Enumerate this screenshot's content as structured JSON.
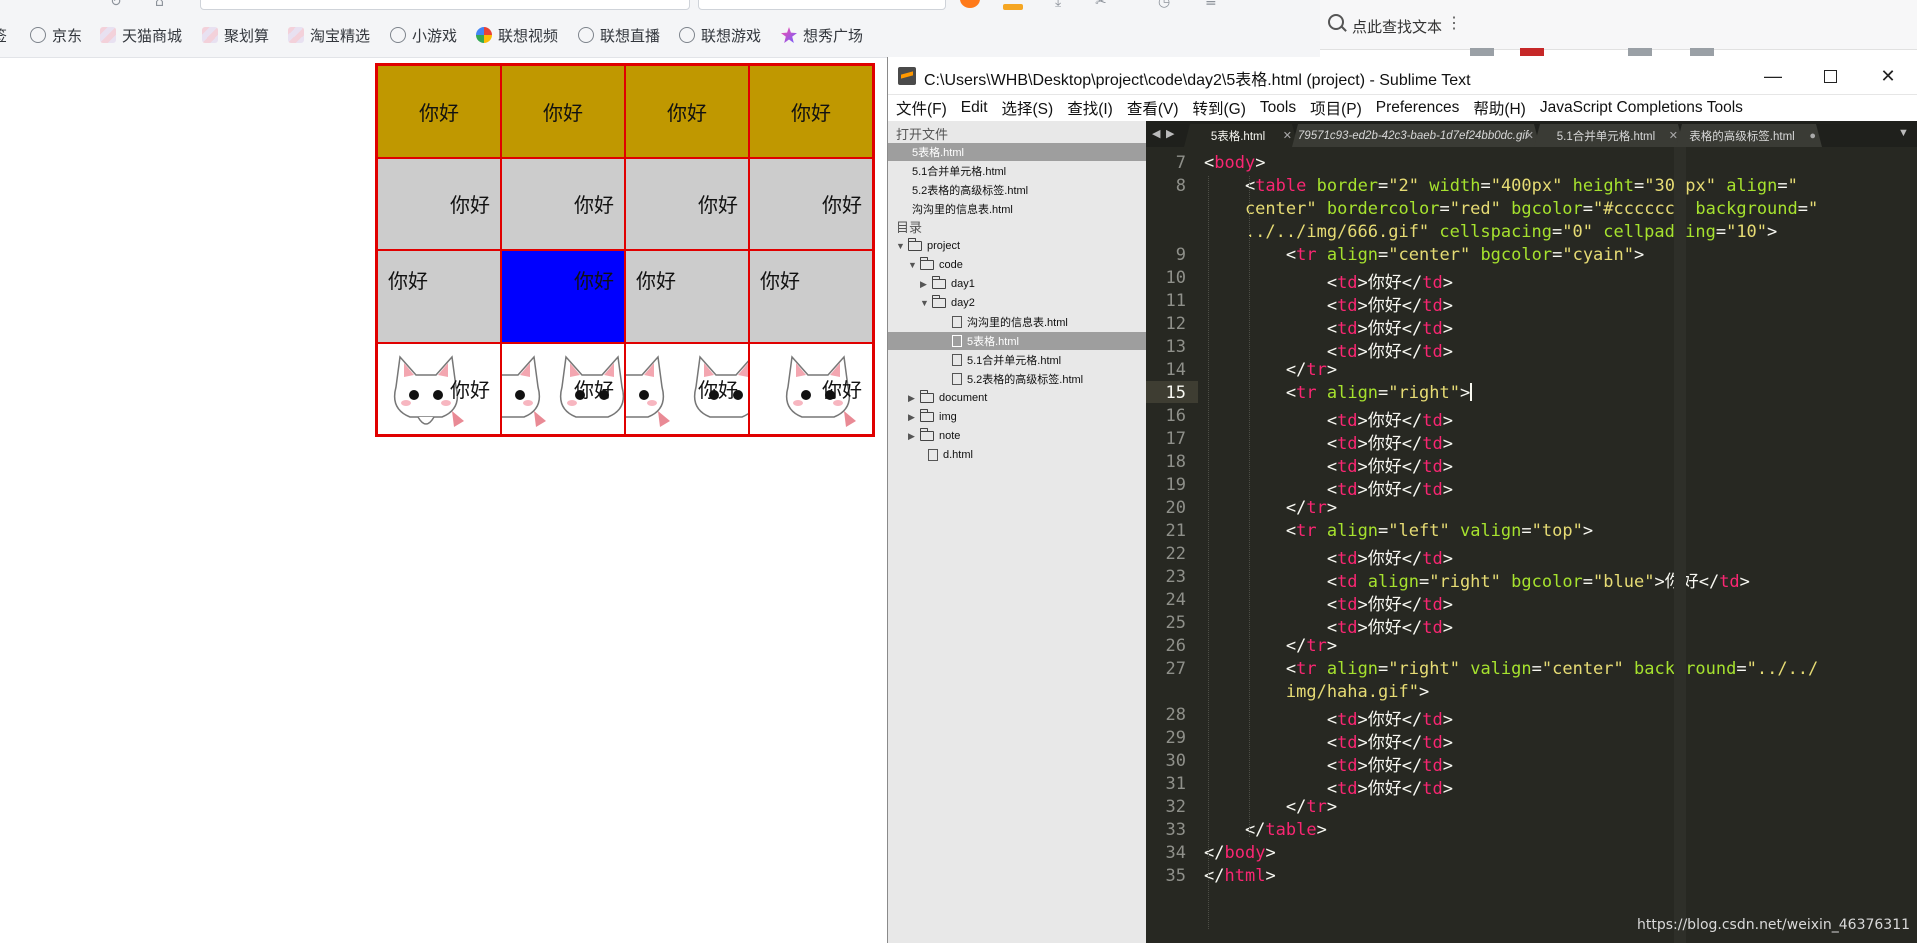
{
  "browser": {
    "bookmarks": [
      {
        "label": "京东",
        "icon": "globe-icon"
      },
      {
        "label": "天猫商城",
        "icon": "brand-icon"
      },
      {
        "label": "聚划算",
        "icon": "brand-icon"
      },
      {
        "label": "淘宝精选",
        "icon": "brand-icon"
      },
      {
        "label": "小游戏",
        "icon": "globe-icon"
      },
      {
        "label": "联想视频",
        "icon": "video-icon"
      },
      {
        "label": "联想直播",
        "icon": "globe-icon"
      },
      {
        "label": "联想游戏",
        "icon": "globe-icon"
      },
      {
        "label": "想秀广场",
        "icon": "star-icon"
      }
    ]
  },
  "table": {
    "rows": [
      [
        "你好",
        "你好",
        "你好",
        "你好"
      ],
      [
        "你好",
        "你好",
        "你好",
        "你好"
      ],
      [
        "你好",
        "你好",
        "你好",
        "你好"
      ],
      [
        "你好",
        "你好",
        "你好",
        "你好"
      ]
    ],
    "colors": {
      "row1": "#c09800",
      "default": "#cccccc",
      "highlight": "#0000ff",
      "border": "#e00000"
    }
  },
  "reader": {
    "search_label": "点此查找文本",
    "more_glyph": "⋮"
  },
  "sublime": {
    "title": "C:\\Users\\WHB\\Desktop\\project\\code\\day2\\5表格.html (project) - Sublime Text",
    "window_buttons": {
      "minimize": "—",
      "close": "✕"
    },
    "menu": [
      "文件(F)",
      "Edit",
      "选择(S)",
      "查找(I)",
      "查看(V)",
      "转到(G)",
      "Tools",
      "项目(P)",
      "Preferences",
      "帮助(H)",
      "JavaScript Completions Tools"
    ],
    "sidebar": {
      "open_files_header": "打开文件",
      "open_files": [
        "5表格.html",
        "5.1合并单元格.html",
        "5.2表格的高级标签.html",
        "沟沟里的信息表.html"
      ],
      "folders_header": "目录",
      "tree": [
        {
          "label": "project",
          "type": "folder",
          "level": 0,
          "open": true
        },
        {
          "label": "code",
          "type": "folder",
          "level": 1,
          "open": true
        },
        {
          "label": "day1",
          "type": "folder",
          "level": 2,
          "open": false
        },
        {
          "label": "day2",
          "type": "folder",
          "level": 2,
          "open": true
        },
        {
          "label": "沟沟里的信息表.html",
          "type": "file",
          "level": 3
        },
        {
          "label": "5表格.html",
          "type": "file",
          "level": 3,
          "selected": true
        },
        {
          "label": "5.1合并单元格.html",
          "type": "file",
          "level": 3
        },
        {
          "label": "5.2表格的高级标签.html",
          "type": "file",
          "level": 3
        },
        {
          "label": "document",
          "type": "folder",
          "level": 1,
          "open": false
        },
        {
          "label": "img",
          "type": "folder",
          "level": 1,
          "open": false
        },
        {
          "label": "note",
          "type": "folder",
          "level": 1,
          "open": false
        },
        {
          "label": "d.html",
          "type": "file",
          "level": 1
        }
      ]
    },
    "tabs": [
      {
        "label": "5表格.html",
        "active": true
      },
      {
        "label": "79571c93-ed2b-42c3-baeb-1d7ef24bb0dc.gif",
        "italic": true
      },
      {
        "label": "5.1合并单元格.html"
      },
      {
        "label": "表格的高级标签.html",
        "dirty": true
      }
    ],
    "tab_nav": {
      "left": "◀",
      "right": "▶",
      "more": "▼"
    },
    "current_line": "15",
    "lines": [
      {
        "n": "7",
        "code": [
          [
            "t",
            "<"
          ],
          [
            "k",
            "body"
          ],
          [
            "t",
            ">"
          ]
        ]
      },
      {
        "n": "8",
        "code": [
          [
            "t",
            "    <"
          ],
          [
            "k",
            "table"
          ],
          [
            "t",
            " "
          ],
          [
            "a",
            "border"
          ],
          [
            "t",
            "="
          ],
          [
            "s",
            "\"2\""
          ],
          [
            "t",
            " "
          ],
          [
            "a",
            "width"
          ],
          [
            "t",
            "="
          ],
          [
            "s",
            "\"400px\""
          ],
          [
            "t",
            " "
          ],
          [
            "a",
            "height"
          ],
          [
            "t",
            "="
          ],
          [
            "s",
            "\"300px\""
          ],
          [
            "t",
            " "
          ],
          [
            "a",
            "align"
          ],
          [
            "t",
            "="
          ],
          [
            "s",
            "\""
          ]
        ]
      },
      {
        "n": "",
        "code": [
          [
            "s",
            "    center\""
          ],
          [
            "t",
            " "
          ],
          [
            "a",
            "bordercolor"
          ],
          [
            "t",
            "="
          ],
          [
            "s",
            "\"red\""
          ],
          [
            "t",
            " "
          ],
          [
            "a",
            "bgcolor"
          ],
          [
            "t",
            "="
          ],
          [
            "s",
            "\"#cccccc\""
          ],
          [
            "t",
            " "
          ],
          [
            "a",
            "background"
          ],
          [
            "t",
            "="
          ],
          [
            "s",
            "\""
          ]
        ]
      },
      {
        "n": "",
        "code": [
          [
            "s",
            "    ../../img/666.gif\""
          ],
          [
            "t",
            " "
          ],
          [
            "a",
            "cellspacing"
          ],
          [
            "t",
            "="
          ],
          [
            "s",
            "\"0\""
          ],
          [
            "t",
            " "
          ],
          [
            "a",
            "cellpadding"
          ],
          [
            "t",
            "="
          ],
          [
            "s",
            "\"10\""
          ],
          [
            "t",
            ">"
          ]
        ]
      },
      {
        "n": "9",
        "code": [
          [
            "t",
            "        <"
          ],
          [
            "k",
            "tr"
          ],
          [
            "t",
            " "
          ],
          [
            "a",
            "align"
          ],
          [
            "t",
            "="
          ],
          [
            "s",
            "\"center\""
          ],
          [
            "t",
            " "
          ],
          [
            "a",
            "bgcolor"
          ],
          [
            "t",
            "="
          ],
          [
            "s",
            "\"cyain\""
          ],
          [
            "t",
            ">"
          ]
        ]
      },
      {
        "n": "10",
        "code": [
          [
            "t",
            "            <"
          ],
          [
            "k",
            "td"
          ],
          [
            "t",
            ">你好</"
          ],
          [
            "k",
            "td"
          ],
          [
            "t",
            ">"
          ]
        ]
      },
      {
        "n": "11",
        "code": [
          [
            "t",
            "            <"
          ],
          [
            "k",
            "td"
          ],
          [
            "t",
            ">你好</"
          ],
          [
            "k",
            "td"
          ],
          [
            "t",
            ">"
          ]
        ]
      },
      {
        "n": "12",
        "code": [
          [
            "t",
            "            <"
          ],
          [
            "k",
            "td"
          ],
          [
            "t",
            ">你好</"
          ],
          [
            "k",
            "td"
          ],
          [
            "t",
            ">"
          ]
        ]
      },
      {
        "n": "13",
        "code": [
          [
            "t",
            "            <"
          ],
          [
            "k",
            "td"
          ],
          [
            "t",
            ">你好</"
          ],
          [
            "k",
            "td"
          ],
          [
            "t",
            ">"
          ]
        ]
      },
      {
        "n": "14",
        "code": [
          [
            "t",
            "        </"
          ],
          [
            "k",
            "tr"
          ],
          [
            "t",
            ">"
          ]
        ]
      },
      {
        "n": "15",
        "code": [
          [
            "t",
            "        <"
          ],
          [
            "k",
            "tr"
          ],
          [
            "t",
            " "
          ],
          [
            "a",
            "align"
          ],
          [
            "t",
            "="
          ],
          [
            "s",
            "\"right\""
          ],
          [
            "t",
            ">"
          ],
          [
            "c",
            ""
          ]
        ]
      },
      {
        "n": "16",
        "code": [
          [
            "t",
            "            <"
          ],
          [
            "k",
            "td"
          ],
          [
            "t",
            ">你好</"
          ],
          [
            "k",
            "td"
          ],
          [
            "t",
            ">"
          ]
        ]
      },
      {
        "n": "17",
        "code": [
          [
            "t",
            "            <"
          ],
          [
            "k",
            "td"
          ],
          [
            "t",
            ">你好</"
          ],
          [
            "k",
            "td"
          ],
          [
            "t",
            ">"
          ]
        ]
      },
      {
        "n": "18",
        "code": [
          [
            "t",
            "            <"
          ],
          [
            "k",
            "td"
          ],
          [
            "t",
            ">你好</"
          ],
          [
            "k",
            "td"
          ],
          [
            "t",
            ">"
          ]
        ]
      },
      {
        "n": "19",
        "code": [
          [
            "t",
            "            <"
          ],
          [
            "k",
            "td"
          ],
          [
            "t",
            ">你好</"
          ],
          [
            "k",
            "td"
          ],
          [
            "t",
            ">"
          ]
        ]
      },
      {
        "n": "20",
        "code": [
          [
            "t",
            "        </"
          ],
          [
            "k",
            "tr"
          ],
          [
            "t",
            ">"
          ]
        ]
      },
      {
        "n": "21",
        "code": [
          [
            "t",
            "        <"
          ],
          [
            "k",
            "tr"
          ],
          [
            "t",
            " "
          ],
          [
            "a",
            "align"
          ],
          [
            "t",
            "="
          ],
          [
            "s",
            "\"left\""
          ],
          [
            "t",
            " "
          ],
          [
            "a",
            "valign"
          ],
          [
            "t",
            "="
          ],
          [
            "s",
            "\"top\""
          ],
          [
            "t",
            ">"
          ]
        ]
      },
      {
        "n": "22",
        "code": [
          [
            "t",
            "            <"
          ],
          [
            "k",
            "td"
          ],
          [
            "t",
            ">你好</"
          ],
          [
            "k",
            "td"
          ],
          [
            "t",
            ">"
          ]
        ]
      },
      {
        "n": "23",
        "code": [
          [
            "t",
            "            <"
          ],
          [
            "k",
            "td"
          ],
          [
            "t",
            " "
          ],
          [
            "a",
            "align"
          ],
          [
            "t",
            "="
          ],
          [
            "s",
            "\"right\""
          ],
          [
            "t",
            " "
          ],
          [
            "a",
            "bgcolor"
          ],
          [
            "t",
            "="
          ],
          [
            "s",
            "\"blue\""
          ],
          [
            "t",
            ">你好</"
          ],
          [
            "k",
            "td"
          ],
          [
            "t",
            ">"
          ]
        ]
      },
      {
        "n": "24",
        "code": [
          [
            "t",
            "            <"
          ],
          [
            "k",
            "td"
          ],
          [
            "t",
            ">你好</"
          ],
          [
            "k",
            "td"
          ],
          [
            "t",
            ">"
          ]
        ]
      },
      {
        "n": "25",
        "code": [
          [
            "t",
            "            <"
          ],
          [
            "k",
            "td"
          ],
          [
            "t",
            ">你好</"
          ],
          [
            "k",
            "td"
          ],
          [
            "t",
            ">"
          ]
        ]
      },
      {
        "n": "26",
        "code": [
          [
            "t",
            "        </"
          ],
          [
            "k",
            "tr"
          ],
          [
            "t",
            ">"
          ]
        ]
      },
      {
        "n": "27",
        "code": [
          [
            "t",
            "        <"
          ],
          [
            "k",
            "tr"
          ],
          [
            "t",
            " "
          ],
          [
            "a",
            "align"
          ],
          [
            "t",
            "="
          ],
          [
            "s",
            "\"right\""
          ],
          [
            "t",
            " "
          ],
          [
            "a",
            "valign"
          ],
          [
            "t",
            "="
          ],
          [
            "s",
            "\"center\""
          ],
          [
            "t",
            " "
          ],
          [
            "a",
            "background"
          ],
          [
            "t",
            "="
          ],
          [
            "s",
            "\"../../"
          ]
        ]
      },
      {
        "n": "",
        "code": [
          [
            "s",
            "        img/haha.gif\""
          ],
          [
            "t",
            ">"
          ]
        ]
      },
      {
        "n": "28",
        "code": [
          [
            "t",
            "            <"
          ],
          [
            "k",
            "td"
          ],
          [
            "t",
            ">你好</"
          ],
          [
            "k",
            "td"
          ],
          [
            "t",
            ">"
          ]
        ]
      },
      {
        "n": "29",
        "code": [
          [
            "t",
            "            <"
          ],
          [
            "k",
            "td"
          ],
          [
            "t",
            ">你好</"
          ],
          [
            "k",
            "td"
          ],
          [
            "t",
            ">"
          ]
        ]
      },
      {
        "n": "30",
        "code": [
          [
            "t",
            "            <"
          ],
          [
            "k",
            "td"
          ],
          [
            "t",
            ">你好</"
          ],
          [
            "k",
            "td"
          ],
          [
            "t",
            ">"
          ]
        ]
      },
      {
        "n": "31",
        "code": [
          [
            "t",
            "            <"
          ],
          [
            "k",
            "td"
          ],
          [
            "t",
            ">你好</"
          ],
          [
            "k",
            "td"
          ],
          [
            "t",
            ">"
          ]
        ]
      },
      {
        "n": "32",
        "code": [
          [
            "t",
            "        </"
          ],
          [
            "k",
            "tr"
          ],
          [
            "t",
            ">"
          ]
        ]
      },
      {
        "n": "33",
        "code": [
          [
            "t",
            "    </"
          ],
          [
            "k",
            "table"
          ],
          [
            "t",
            ">"
          ]
        ]
      },
      {
        "n": "34",
        "code": [
          [
            "t",
            "</"
          ],
          [
            "k",
            "body"
          ],
          [
            "t",
            ">"
          ]
        ]
      },
      {
        "n": "35",
        "code": [
          [
            "t",
            "</"
          ],
          [
            "k",
            "html"
          ],
          [
            "t",
            ">"
          ]
        ]
      }
    ]
  },
  "watermark": "https://blog.csdn.net/weixin_46376311"
}
